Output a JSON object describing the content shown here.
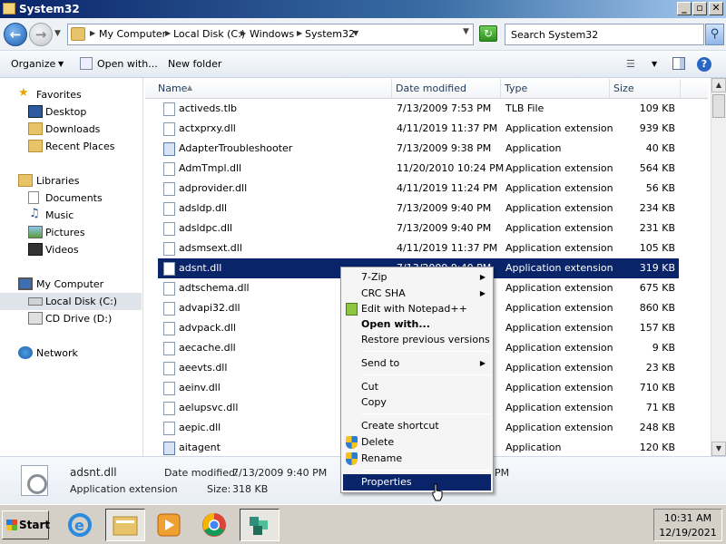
{
  "window": {
    "title": "System32",
    "controls": {
      "minimize": "_",
      "maximize": "▫",
      "close": "✕"
    }
  },
  "address": {
    "breadcrumbs": [
      "My Computer",
      "Local Disk (C:)",
      "Windows",
      "System32"
    ],
    "search_placeholder": "Search System32"
  },
  "toolbar": {
    "organize": "Organize",
    "open_with": "Open with...",
    "new_folder": "New folder"
  },
  "nav": {
    "favorites_label": "Favorites",
    "favorites": [
      "Desktop",
      "Downloads",
      "Recent Places"
    ],
    "libraries_label": "Libraries",
    "libraries": [
      "Documents",
      "Music",
      "Pictures",
      "Videos"
    ],
    "computer_label": "My Computer",
    "drives": [
      "Local Disk (C:)",
      "CD Drive (D:)"
    ],
    "network_label": "Network"
  },
  "columns": [
    "Name",
    "Date modified",
    "Type",
    "Size"
  ],
  "files": [
    {
      "name": "activeds.tlb",
      "date": "7/13/2009 7:53 PM",
      "type": "TLB File",
      "size": "109 KB"
    },
    {
      "name": "actxprxy.dll",
      "date": "4/11/2019 11:37 PM",
      "type": "Application extension",
      "size": "939 KB"
    },
    {
      "name": "AdapterTroubleshooter",
      "date": "7/13/2009 9:38 PM",
      "type": "Application",
      "size": "40 KB"
    },
    {
      "name": "AdmTmpl.dll",
      "date": "11/20/2010 10:24 PM",
      "type": "Application extension",
      "size": "564 KB"
    },
    {
      "name": "adprovider.dll",
      "date": "4/11/2019 11:24 PM",
      "type": "Application extension",
      "size": "56 KB"
    },
    {
      "name": "adsldp.dll",
      "date": "7/13/2009 9:40 PM",
      "type": "Application extension",
      "size": "234 KB"
    },
    {
      "name": "adsldpc.dll",
      "date": "7/13/2009 9:40 PM",
      "type": "Application extension",
      "size": "231 KB"
    },
    {
      "name": "adsmsext.dll",
      "date": "4/11/2019 11:37 PM",
      "type": "Application extension",
      "size": "105 KB"
    },
    {
      "name": "adsnt.dll",
      "date": "7/13/2009 9:40 PM",
      "type": "Application extension",
      "size": "319 KB"
    },
    {
      "name": "adtschema.dll",
      "date": "",
      "type": "Application extension",
      "size": "675 KB"
    },
    {
      "name": "advapi32.dll",
      "date": "",
      "type": "Application extension",
      "size": "860 KB"
    },
    {
      "name": "advpack.dll",
      "date": "",
      "type": "Application extension",
      "size": "157 KB"
    },
    {
      "name": "aecache.dll",
      "date": "",
      "type": "Application extension",
      "size": "9 KB"
    },
    {
      "name": "aeevts.dll",
      "date": "",
      "type": "Application extension",
      "size": "23 KB"
    },
    {
      "name": "aeinv.dll",
      "date": "",
      "type": "Application extension",
      "size": "710 KB"
    },
    {
      "name": "aelupsvc.dll",
      "date": "",
      "type": "Application extension",
      "size": "71 KB"
    },
    {
      "name": "aepic.dll",
      "date": "",
      "type": "Application extension",
      "size": "248 KB"
    },
    {
      "name": "aitagent",
      "date": "",
      "type": "Application",
      "size": "120 KB"
    }
  ],
  "details": {
    "name": "adsnt.dll",
    "type": "Application extension",
    "date_label": "Date modified:",
    "date_value": "7/13/2009 9:40 PM",
    "size_label": "Size:",
    "size_value": "318 KB",
    "partial": "PM"
  },
  "context_menu": {
    "items": [
      "7-Zip",
      "CRC SHA",
      "Edit with Notepad++",
      "Open with...",
      "Restore previous versions",
      "Send to",
      "Cut",
      "Copy",
      "Create shortcut",
      "Delete",
      "Rename",
      "Properties"
    ]
  },
  "taskbar": {
    "start": "Start",
    "time": "10:31 AM",
    "date": "12/19/2021"
  },
  "colors": {
    "selection": "#0a246a",
    "title_start": "#0a246a"
  }
}
